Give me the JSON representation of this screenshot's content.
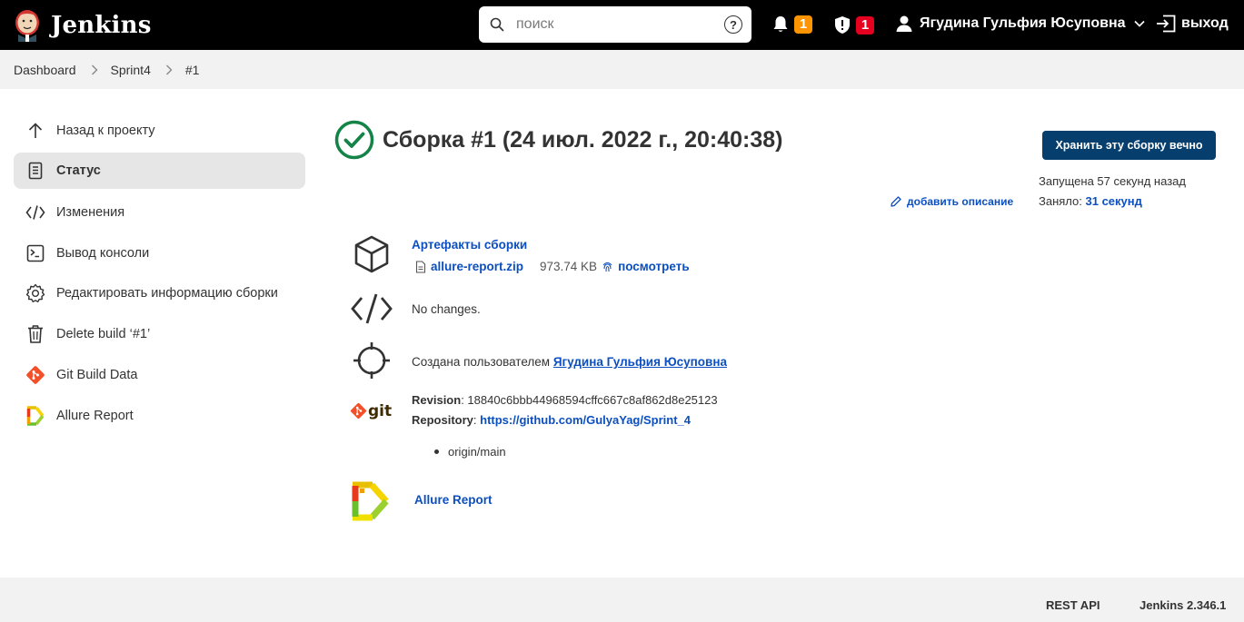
{
  "header": {
    "app_name": "Jenkins",
    "search_placeholder": "поиск",
    "help_label": "?",
    "notifications_count": "1",
    "security_count": "1",
    "user_name": "Ягудина Гульфия Юсуповна",
    "logout_label": "выход"
  },
  "breadcrumb": {
    "items": [
      "Dashboard",
      "Sprint4",
      "#1"
    ]
  },
  "sidebar": {
    "items": [
      {
        "label": "Назад к проекту",
        "icon": "arrow-up-icon"
      },
      {
        "label": "Статус",
        "icon": "document-icon",
        "active": true
      },
      {
        "label": "Изменения",
        "icon": "code-icon"
      },
      {
        "label": "Вывод консоли",
        "icon": "terminal-icon"
      },
      {
        "label": "Редактировать информацию сборки",
        "icon": "gear-icon"
      },
      {
        "label": "Delete build ‘#1’",
        "icon": "trash-icon"
      },
      {
        "label": "Git Build Data",
        "icon": "git-icon"
      },
      {
        "label": "Allure Report",
        "icon": "allure-icon"
      }
    ]
  },
  "main": {
    "title": "Сборка #1 (24 июл. 2022 г., 20:40:38)",
    "keep_button": "Хранить эту сборку вечно",
    "started_ago": "Запущена 57 секунд назад",
    "took_label": "Заняло:",
    "took_value": "31 секунд",
    "add_description": "добавить описание",
    "artifacts": {
      "title": "Артефакты сборки",
      "file_name": "allure-report.zip",
      "file_size": "973.74 KB",
      "view_label": "посмотреть"
    },
    "changes_text": "No changes.",
    "started_by_prefix": "Создана пользователем",
    "started_by_user": "Ягудина Гульфия Юсуповна",
    "git": {
      "revision_label": "Revision",
      "revision_value": ": 18840c6bbb44968594cffc667c8af862d8e25123",
      "repository_label": "Repository",
      "repository_sep": ": ",
      "repository_url": "https://github.com/GulyaYag/Sprint_4",
      "branch": "origin/main",
      "logo_text": "git"
    },
    "allure_link": "Allure Report"
  },
  "footer": {
    "rest_api": "REST API",
    "version": "Jenkins 2.346.1"
  },
  "colors": {
    "header_bg": "#000000",
    "link": "#0b4fc0",
    "success": "#138347",
    "button_bg": "#063e6e",
    "badge_orange": "#fe9400",
    "badge_red": "#e6001f"
  }
}
